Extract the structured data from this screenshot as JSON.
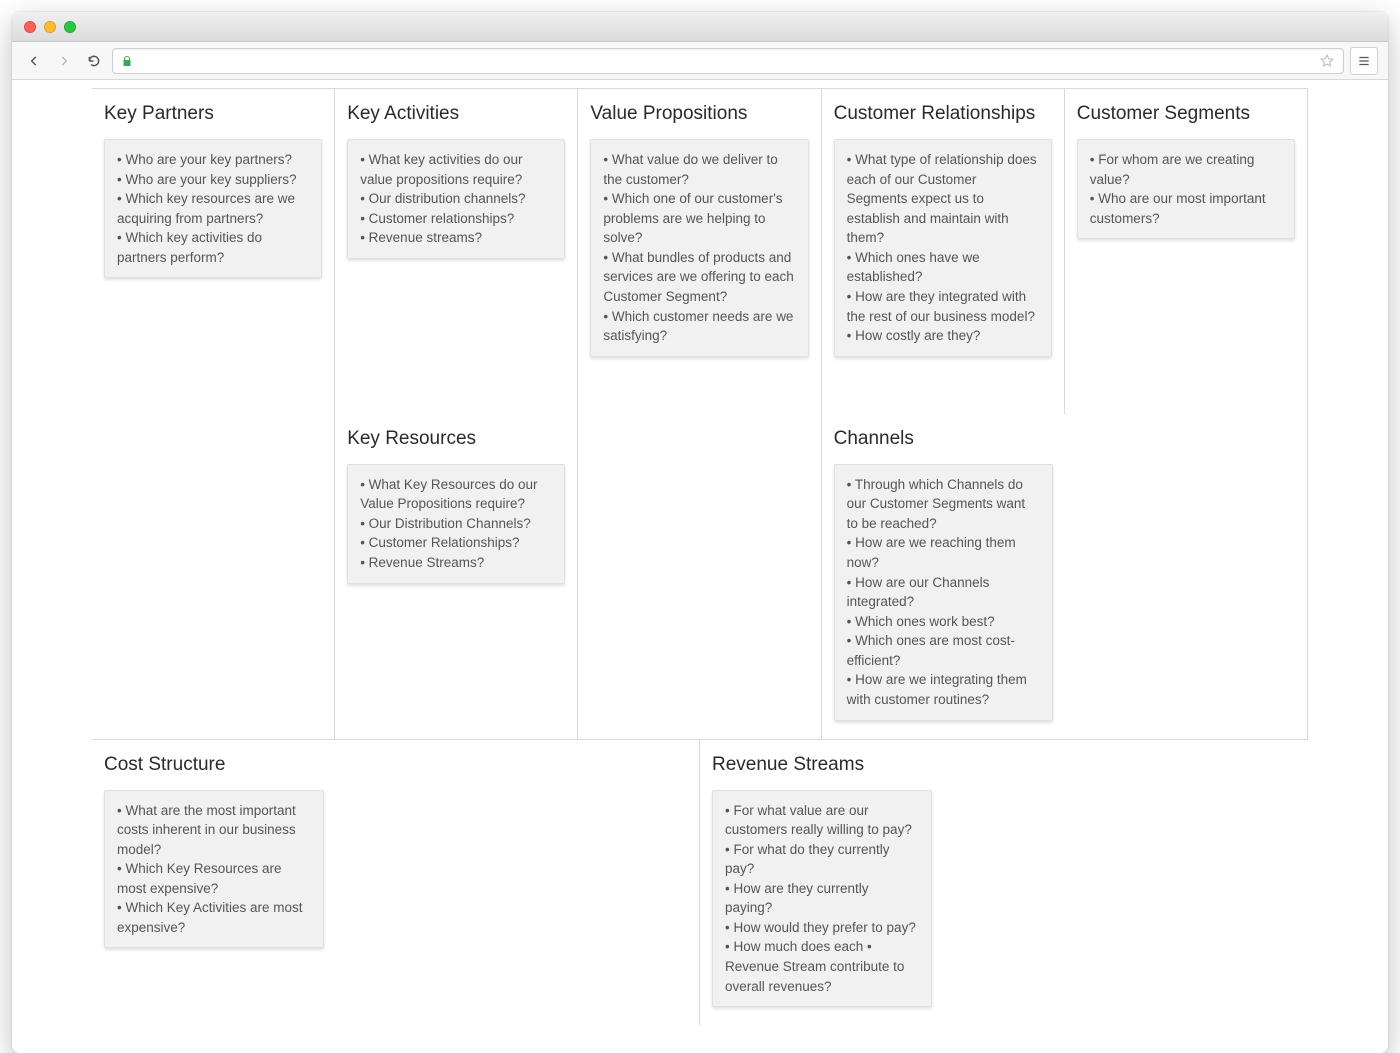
{
  "bullet": "•",
  "sections": {
    "key_partners": {
      "title": "Key Partners",
      "items": [
        "Who are your key partners?",
        "Who are your key suppliers?",
        "Which key resources are we acquiring from partners?",
        "Which key activities do partners perform?"
      ]
    },
    "key_activities": {
      "title": "Key Activities",
      "items": [
        "What key activities do our value propositions require?",
        "Our distribution channels?",
        "Customer relationships?",
        "Revenue streams?"
      ]
    },
    "key_resources": {
      "title": "Key Resources",
      "items": [
        "What Key Resources do our Value Propositions require?",
        "Our Distribution Channels?",
        "Customer Relationships?",
        "Revenue Streams?"
      ]
    },
    "value_propositions": {
      "title": "Value Propositions",
      "items": [
        "What value do we deliver to the customer?",
        "Which one of our customer's problems are we helping to solve?",
        "What bundles of products and services are we offering to each Customer Segment?",
        "Which customer needs are we satisfying?"
      ]
    },
    "customer_relationships": {
      "title": "Customer Relationships",
      "items": [
        "What type of relationship does each of our Customer Segments expect us to establish and maintain with them?",
        "Which ones have we established?",
        "How are they integrated with the rest of our business model?",
        "How costly are they?"
      ]
    },
    "channels": {
      "title": "Channels",
      "items": [
        "Through which Channels do our Customer Segments want to be reached?",
        "How are we reaching them now?",
        "How are our Channels integrated?",
        "Which ones work best?",
        "Which ones are most cost-efficient?",
        "How are we integrating them with customer routines?"
      ]
    },
    "customer_segments": {
      "title": "Customer Segments",
      "items": [
        "For whom are we creating value?",
        "Who are our most important customers?"
      ]
    },
    "cost_structure": {
      "title": "Cost Structure",
      "items": [
        "What are the most important costs inherent in our business model?",
        "Which Key Resources are most expensive?",
        "Which Key Activities are most expensive?"
      ]
    },
    "revenue_streams": {
      "title": "Revenue Streams",
      "items": [
        "For what value are our customers really willing to pay?",
        "For what do they currently pay?",
        "How are they currently paying?",
        "How would they prefer to pay?",
        "How much does each • Revenue Stream contribute to overall revenues?"
      ]
    }
  }
}
